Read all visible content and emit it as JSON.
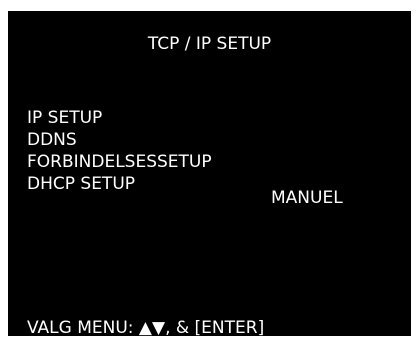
{
  "title": "TCP / IP SETUP",
  "menu": {
    "items": [
      {
        "label": "IP SETUP"
      },
      {
        "label": "DDNS"
      },
      {
        "label": "FORBINDELSESSETUP"
      },
      {
        "label": "DHCP SETUP",
        "value": "MANUEL"
      }
    ]
  },
  "footer": {
    "text": "VALG MENU: ▲▼, &  [ENTER]"
  },
  "colors": {
    "background": "#000000",
    "text": "#ffffff"
  }
}
